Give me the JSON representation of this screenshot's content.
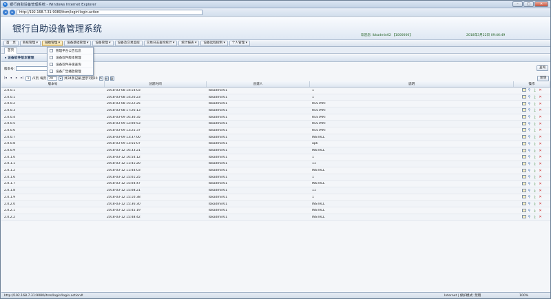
{
  "window": {
    "title": "银行自助设备管理系统 - Windows Internet Explorer",
    "url": "http://192.168.7.31:9080/itsm/login!login.action"
  },
  "header": {
    "app_title": "银行自助设备管理系统",
    "welcome": "欢迎您: lbkadmin02 【1000000】",
    "datetime": "2018年3月22日 09:46:49"
  },
  "menu": {
    "items": [
      {
        "label": "首　页"
      },
      {
        "label": "系统管理 ▾"
      },
      {
        "label": "辅助管理 ▾"
      },
      {
        "label": "设备基础管理 ▾"
      },
      {
        "label": "设备管理 ▾"
      },
      {
        "label": "设备及交易监控"
      },
      {
        "label": "交易日志查询统计 ▾"
      },
      {
        "label": "统计报表 ▾"
      },
      {
        "label": "设备远程控制 ▾"
      },
      {
        "label": "个人管理 ▾"
      }
    ]
  },
  "dropdown": {
    "items": [
      {
        "label": "管理平台公告信息"
      },
      {
        "label": "设备软件版本管理"
      },
      {
        "label": "设备软件升级查询"
      },
      {
        "label": "设备广告播放管理"
      }
    ]
  },
  "tab": {
    "label": "首页"
  },
  "panel": {
    "title": "▸ 设备软件版本管理"
  },
  "search": {
    "label": "版本号:",
    "value": "",
    "query_button": "查询"
  },
  "toolbar": {
    "add_button": "新增"
  },
  "pager": {
    "first": "|◂",
    "prev": "◂",
    "next": "▸",
    "last": "▸|",
    "page": "1",
    "total_pages": "/2页",
    "per_page_label": "每页",
    "per_page": "20",
    "summary": "共34条记录,显示1到20"
  },
  "grid": {
    "headers": [
      "版本号",
      "创建时间",
      "创建人",
      "说明",
      "操作"
    ],
    "rows": [
      {
        "version": "2.0.0.1",
        "created": "2018-03-08 14:14:03",
        "creator": "lbkadmin01",
        "desc": "1"
      },
      {
        "version": "2.0.0.1",
        "created": "2018-03-08 14:20:23",
        "creator": "lbkadmin01",
        "desc": "1"
      },
      {
        "version": "2.0.0.2",
        "created": "2018-03-08 15:22:25",
        "creator": "lbkadmin01",
        "desc": "RESTART"
      },
      {
        "version": "2.0.0.3",
        "created": "2018-03-08 17:26:13",
        "creator": "lbkadmin01",
        "desc": "RESTART"
      },
      {
        "version": "2.0.0.4",
        "created": "2018-03-09 10:30:35",
        "creator": "lbkadmin01",
        "desc": "RESTART"
      },
      {
        "version": "2.0.0.5",
        "created": "2018-03-09 12:00:53",
        "creator": "lbkadmin01",
        "desc": "RESTART"
      },
      {
        "version": "2.0.0.6",
        "created": "2018-03-09 13:25:37",
        "creator": "lbkadmin01",
        "desc": "RESTART"
      },
      {
        "version": "2.0.0.7",
        "created": "2018-03-09 13:37:00",
        "creator": "lbkadmin01",
        "desc": "INSTALL"
      },
      {
        "version": "2.0.0.8",
        "created": "2018-03-09 13:55:07",
        "creator": "lbkadmin01",
        "desc": "apk"
      },
      {
        "version": "2.0.0.9",
        "created": "2018-03-12 10:33:21",
        "creator": "lbkadmin01",
        "desc": "INSTALL"
      },
      {
        "version": "2.0.1.0",
        "created": "2018-03-12 10:54:12",
        "creator": "lbkadmin01",
        "desc": "1"
      },
      {
        "version": "2.0.1.1",
        "created": "2018-03-12 11:41:20",
        "creator": "lbkadmin01",
        "desc": "11"
      },
      {
        "version": "2.0.1.2",
        "created": "2018-03-12 11:44:03",
        "creator": "lbkadmin01",
        "desc": "INSTALL"
      },
      {
        "version": "2.0.1.6",
        "created": "2018-03-12 15:01:25",
        "creator": "lbkadmin01",
        "desc": "1"
      },
      {
        "version": "2.0.1.7",
        "created": "2018-03-12 15:04:47",
        "creator": "lbkadmin01",
        "desc": "INSTALL"
      },
      {
        "version": "2.0.1.8",
        "created": "2018-03-12 15:08:21",
        "creator": "lbkadmin01",
        "desc": "11"
      },
      {
        "version": "2.0.1.9",
        "created": "2018-03-12 15:10:38",
        "creator": "lbkadmin01",
        "desc": "1"
      },
      {
        "version": "2.0.2.0",
        "created": "2018-03-12 15:36:30",
        "creator": "lbkadmin01",
        "desc": "INSTALL"
      },
      {
        "version": "2.0.2.1",
        "created": "2018-03-12 15:45:19",
        "creator": "lbkadmin01",
        "desc": "INSTALL"
      },
      {
        "version": "2.0.2.2",
        "created": "2018-03-12 15:48:42",
        "creator": "lbkadmin01",
        "desc": "INSTALL"
      }
    ]
  },
  "status": {
    "url": "http://192.168.7.31:9080/itsm/login!login.action#",
    "zone": "Internet | 保护模式: 禁用",
    "zoom": "100%"
  },
  "icons": {
    "edit": "edit-icon",
    "view": "magnifier-icon",
    "download": "download-icon",
    "delete": "delete-icon"
  },
  "colors": {
    "title": "#1f3658",
    "welcome": "#1d5e1d",
    "delete": "#cc2222"
  }
}
